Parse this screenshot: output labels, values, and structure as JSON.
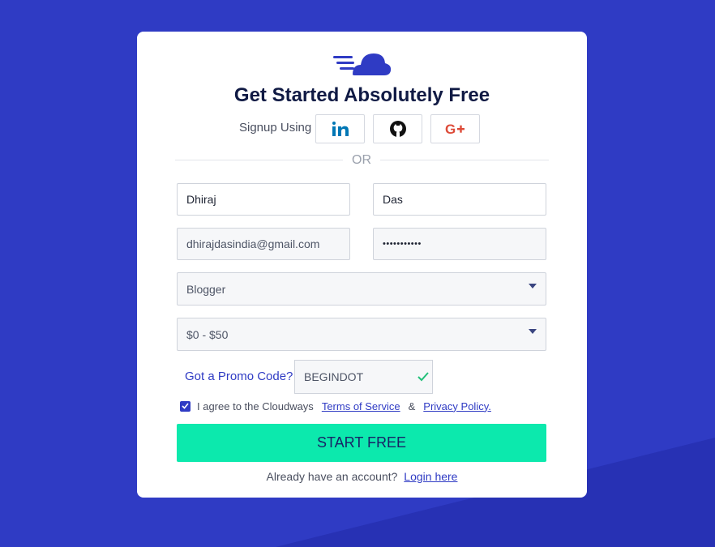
{
  "colors": {
    "background": "#2f3bc4",
    "accent": "#2f3bc4",
    "cta": "#0ce9ad",
    "heading": "#101a44"
  },
  "logo": {
    "icon": "cloud-logo-icon"
  },
  "title": "Get Started Absolutely Free",
  "signup": {
    "label": "Signup Using",
    "providers": [
      {
        "name": "LinkedIn",
        "icon": "linkedin-icon"
      },
      {
        "name": "GitHub",
        "icon": "github-icon"
      },
      {
        "name": "Google Plus",
        "icon": "google-plus-icon"
      }
    ]
  },
  "divider_text": "OR",
  "form": {
    "first_name": "Dhiraj",
    "last_name": "Das",
    "email": "dhirajdasindia@gmail.com",
    "password_mask": "•••••••••••",
    "role_select": {
      "selected": "Blogger"
    },
    "budget_select": {
      "selected": "$0 - $50"
    },
    "promo": {
      "label": "Got a Promo Code?",
      "value": "BEGINDOT",
      "valid": true
    }
  },
  "agreement": {
    "checked": true,
    "prefix": "I agree to the Cloudways",
    "terms_link": "Terms of Service",
    "separator": "&",
    "privacy_link": "Privacy Policy."
  },
  "cta": {
    "label": "START FREE"
  },
  "login": {
    "prompt": "Already have an account?",
    "link": "Login here"
  }
}
